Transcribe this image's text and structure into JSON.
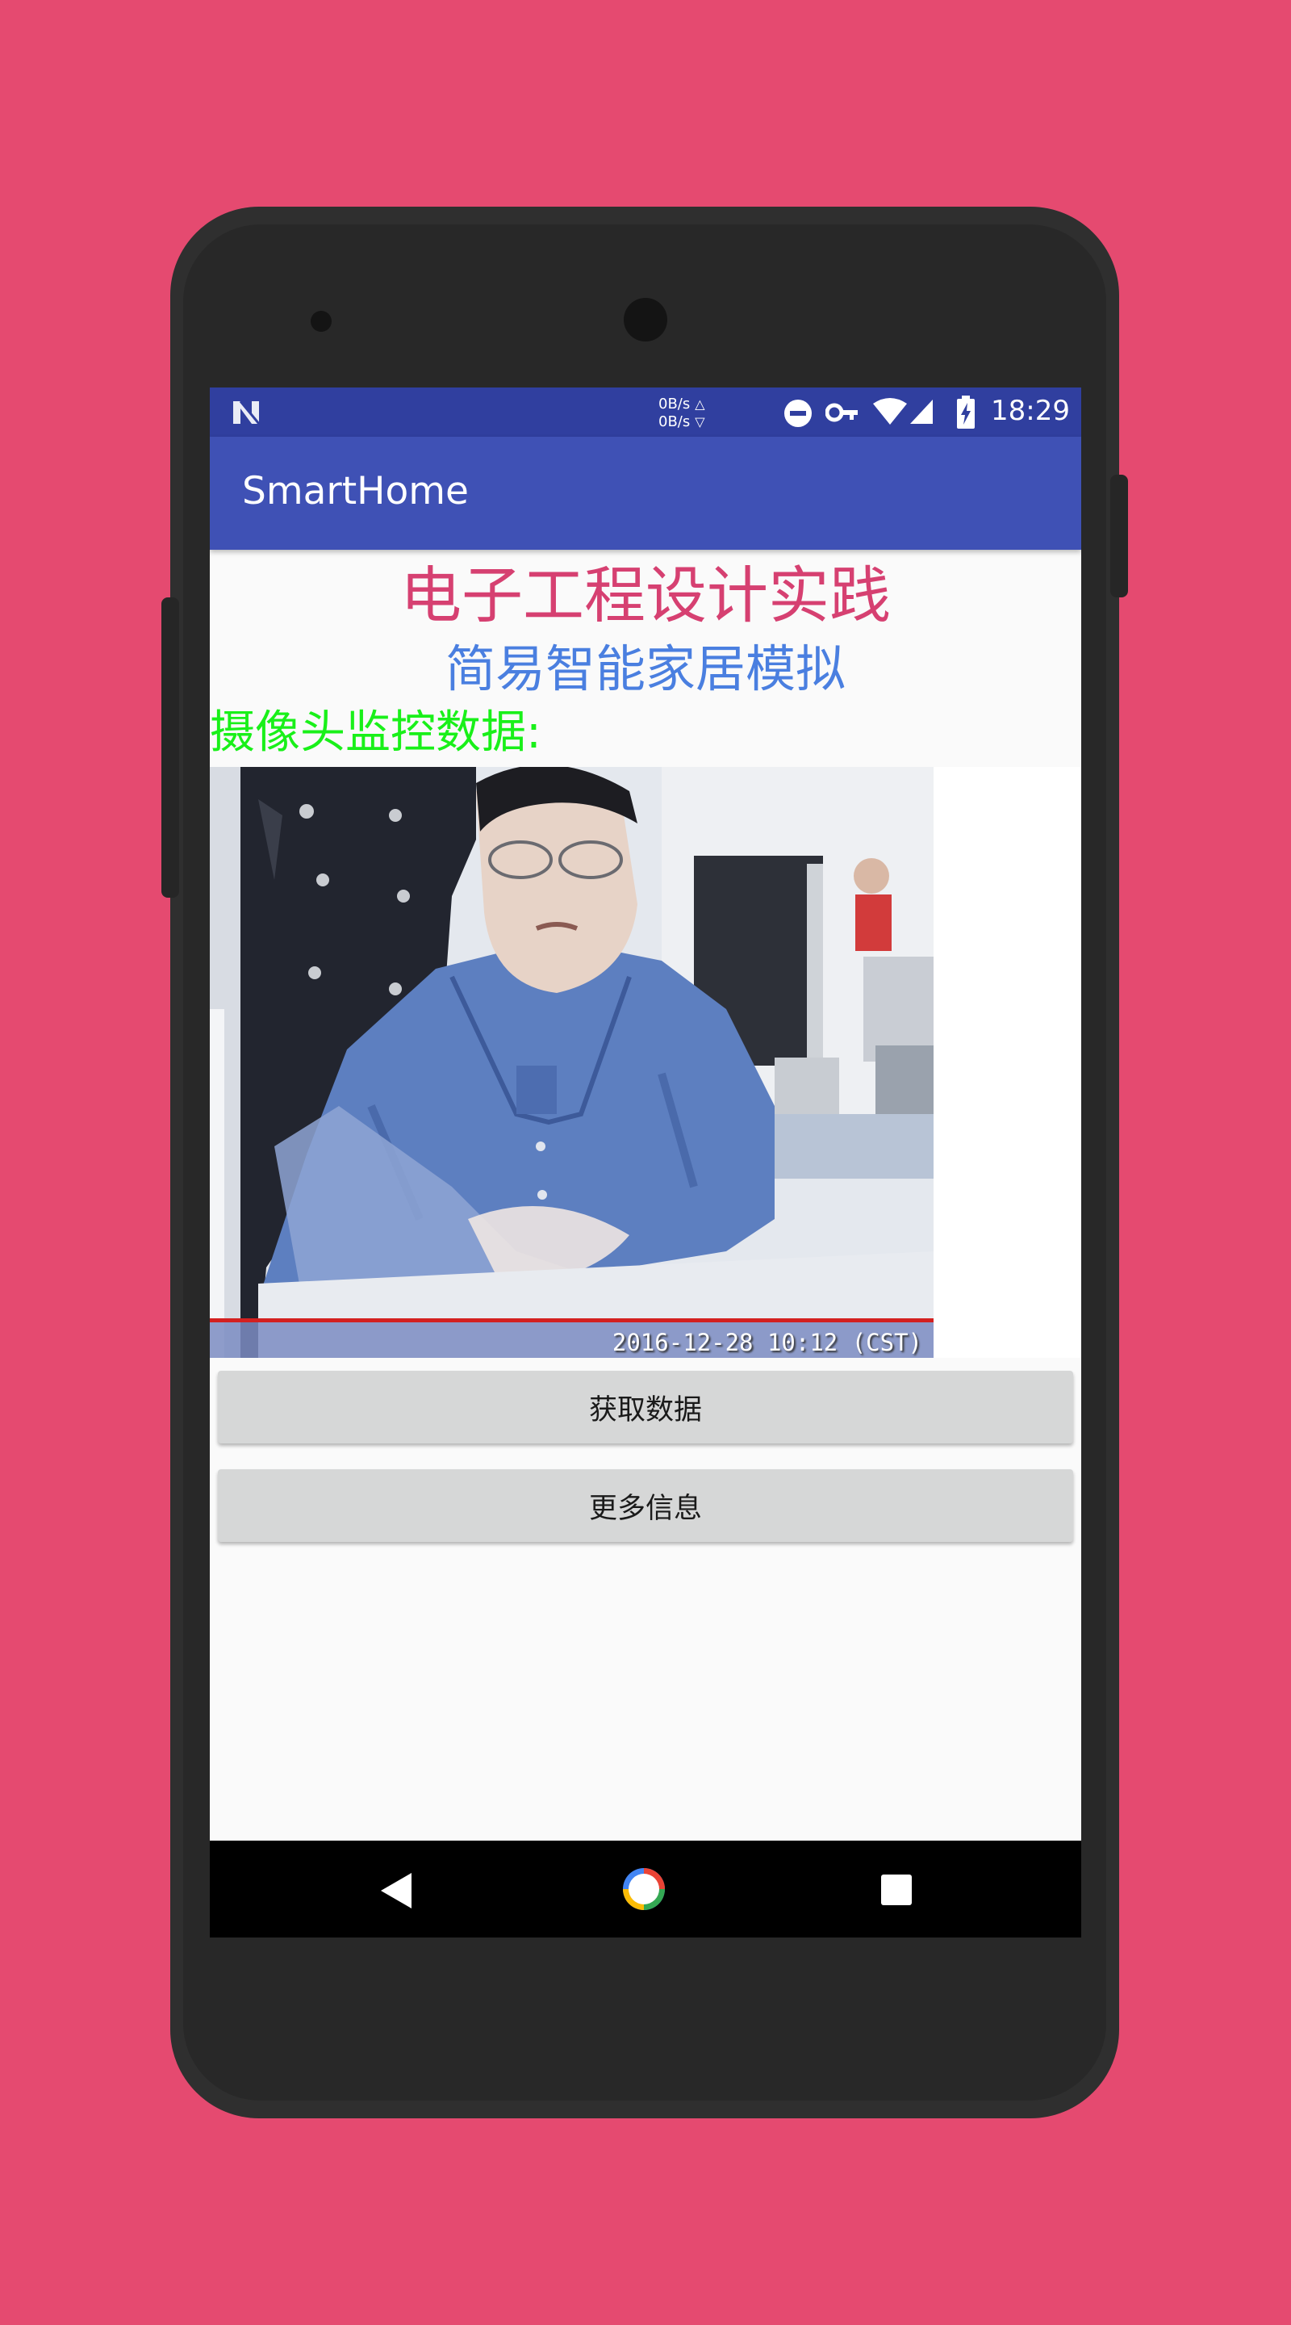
{
  "status_bar": {
    "net_up": "0B/s",
    "net_down": "0B/s",
    "time": "18:29",
    "icons": [
      "android-n-icon",
      "do-not-disturb-icon",
      "vpn-key-icon",
      "wifi-icon",
      "cell-signal-icon",
      "battery-charging-icon"
    ]
  },
  "app_bar": {
    "title": "SmartHome"
  },
  "content": {
    "title": "电子工程设计实践",
    "subtitle": "简易智能家居模拟",
    "camera_label": "摄像头监控数据:",
    "camera_timestamp": "2016-12-28 10:12 (CST)",
    "colors": {
      "title": "#d64071",
      "subtitle": "#4a7fe0",
      "camera_label": "#19f019"
    }
  },
  "buttons": {
    "fetch_data": "获取数据",
    "more_info": "更多信息"
  },
  "nav_bar": {
    "icons": [
      "back-icon",
      "home-icon",
      "recents-icon"
    ]
  },
  "colors": {
    "background": "#e54a70",
    "status_bar": "#303f9f",
    "app_bar": "#3f51b5"
  }
}
